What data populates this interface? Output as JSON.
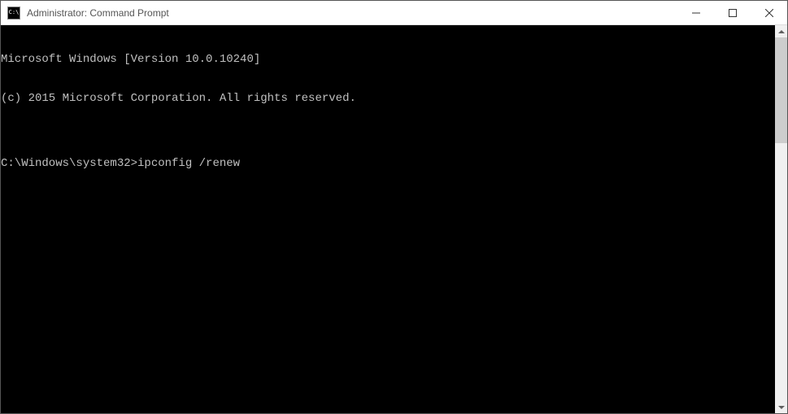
{
  "window": {
    "title": "Administrator: Command Prompt",
    "icon_text": "C:\\"
  },
  "terminal": {
    "lines": [
      "Microsoft Windows [Version 10.0.10240]",
      "(c) 2015 Microsoft Corporation. All rights reserved.",
      "",
      "C:\\Windows\\system32>ipconfig /renew"
    ]
  }
}
